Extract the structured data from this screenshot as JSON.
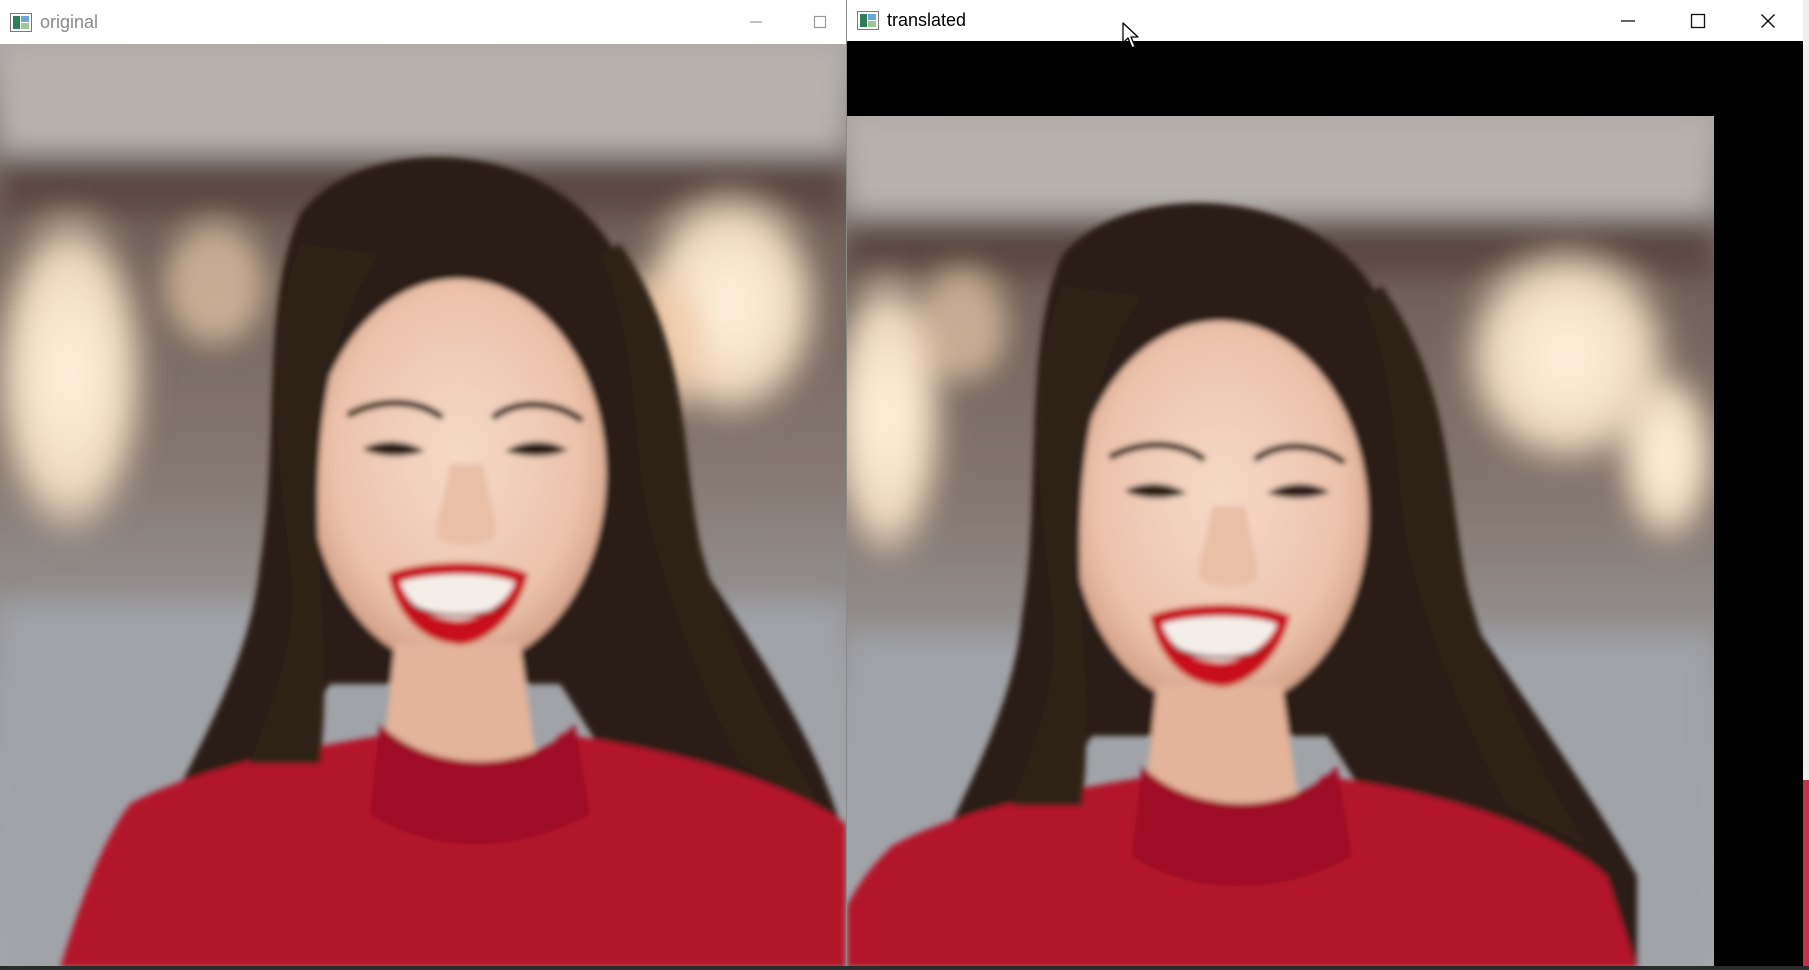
{
  "windows": {
    "original": {
      "title": "original",
      "icon": "opencv-window-icon",
      "controls": [
        "minimize-icon",
        "maximize-icon"
      ]
    },
    "translated": {
      "title": "translated",
      "icon": "opencv-window-icon",
      "controls": [
        "minimize-icon",
        "maximize-icon",
        "close-icon"
      ]
    }
  },
  "colors": {
    "translated_padding": "#000000",
    "sweater": "#b3132a",
    "lips": "#c8111d",
    "hair": "#241812"
  }
}
